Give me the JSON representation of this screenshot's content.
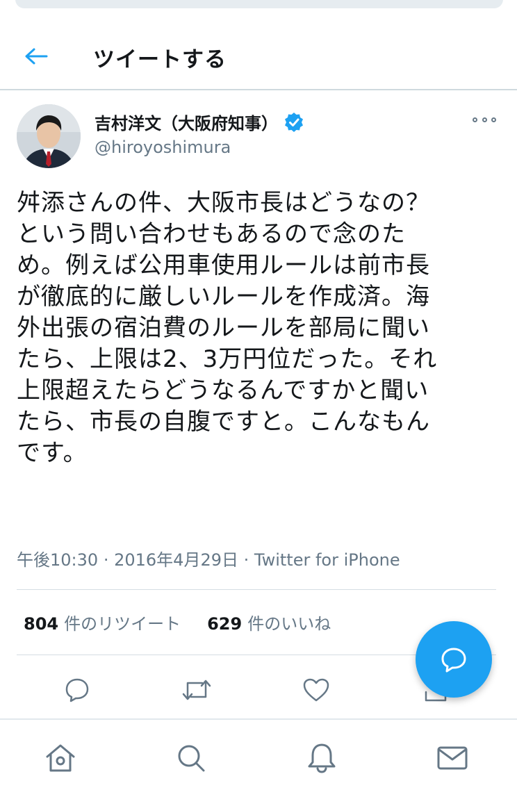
{
  "header": {
    "title": "ツイートする",
    "back_icon": "arrow-left-icon"
  },
  "tweet": {
    "author": {
      "display_name": "吉村洋文（大阪府知事）",
      "handle": "@hiroyoshimura",
      "verified": true
    },
    "text": "舛添さんの件、大阪市長はどうなの？\nという問い合わせもあるので念のた\nめ。例えば公用車使用ルールは前市長\nが徹底的に厳しいルールを作成済。海\n外出張の宿泊費のルールを部局に聞い\nたら、上限は2、3万円位だった。それ\n上限超えたらどうなるんですかと聞い\nたら、市長の自腹ですと。こんなもん\nです。",
    "time": "午後10:30",
    "date": "2016年4月29日",
    "source": "Twitter for iPhone",
    "separator": "·"
  },
  "stats": {
    "retweets": {
      "count": "804",
      "label": "件のリツイート"
    },
    "likes": {
      "count": "629",
      "label": "件のいいね"
    }
  },
  "actions": [
    "reply-icon",
    "retweet-icon",
    "like-icon",
    "share-icon"
  ],
  "fab": {
    "icon": "new-tweet-icon"
  },
  "tabbar": [
    "home-icon",
    "search-icon",
    "notifications-icon",
    "messages-icon"
  ],
  "colors": {
    "accent": "#1da1f2",
    "secondary_text": "#657786",
    "primary_text": "#14171a",
    "divider": "#e1e8ed"
  }
}
